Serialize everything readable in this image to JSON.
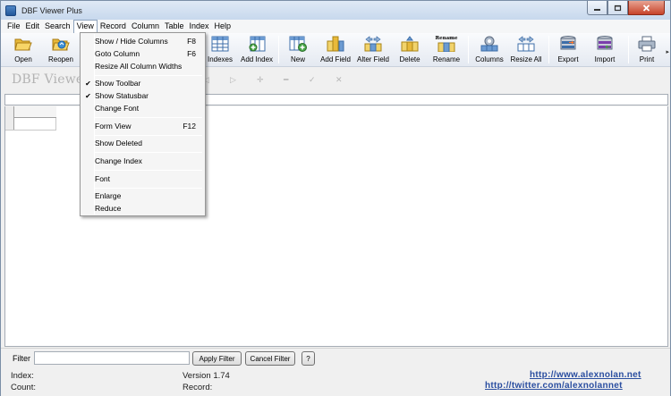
{
  "window": {
    "title": "DBF Viewer Plus"
  },
  "menubar": {
    "items": [
      "File",
      "Edit",
      "Search",
      "View",
      "Record",
      "Column",
      "Table",
      "Index",
      "Help"
    ],
    "active": "View"
  },
  "toolbar": {
    "buttons": [
      "Open",
      "Reopen",
      "Indexes",
      "Add Index",
      "New",
      "Add Field",
      "Alter Field",
      "Delete",
      "Rename",
      "Columns",
      "Resize All",
      "Export",
      "Import",
      "Print"
    ],
    "rename_caption": "Rename"
  },
  "logo": {
    "text": "DBF Viewer"
  },
  "view_menu": {
    "items": [
      {
        "label": "Show / Hide Columns",
        "shortcut": "F8",
        "checked": false
      },
      {
        "label": "Goto Column",
        "shortcut": "F6",
        "checked": false
      },
      {
        "label": "Resize All Column Widths",
        "shortcut": "",
        "checked": false
      },
      {
        "label": "Show Toolbar",
        "shortcut": "",
        "checked": true
      },
      {
        "label": "Show Statusbar",
        "shortcut": "",
        "checked": true
      },
      {
        "label": "Change Font",
        "shortcut": "",
        "checked": false
      },
      {
        "label": "Form View",
        "shortcut": "F12",
        "checked": false
      },
      {
        "label": "Show Deleted",
        "shortcut": "",
        "checked": false
      },
      {
        "label": "Change Index",
        "shortcut": "",
        "checked": false
      },
      {
        "label": "Font",
        "shortcut": "",
        "checked": false
      },
      {
        "label": "Enlarge",
        "shortcut": "",
        "checked": false
      },
      {
        "label": "Reduce",
        "shortcut": "",
        "checked": false
      }
    ]
  },
  "filter": {
    "label": "Filter",
    "value": "",
    "apply_label": "Apply Filter",
    "cancel_label": "Cancel Filter",
    "help_label": "?"
  },
  "status": {
    "index_label": "Index:",
    "count_label": "Count:",
    "version": "Version 1.74",
    "record_label": "Record:",
    "website": "http://www.alexnolan.net",
    "twitter": "http://twitter.com/alexnolannet"
  }
}
